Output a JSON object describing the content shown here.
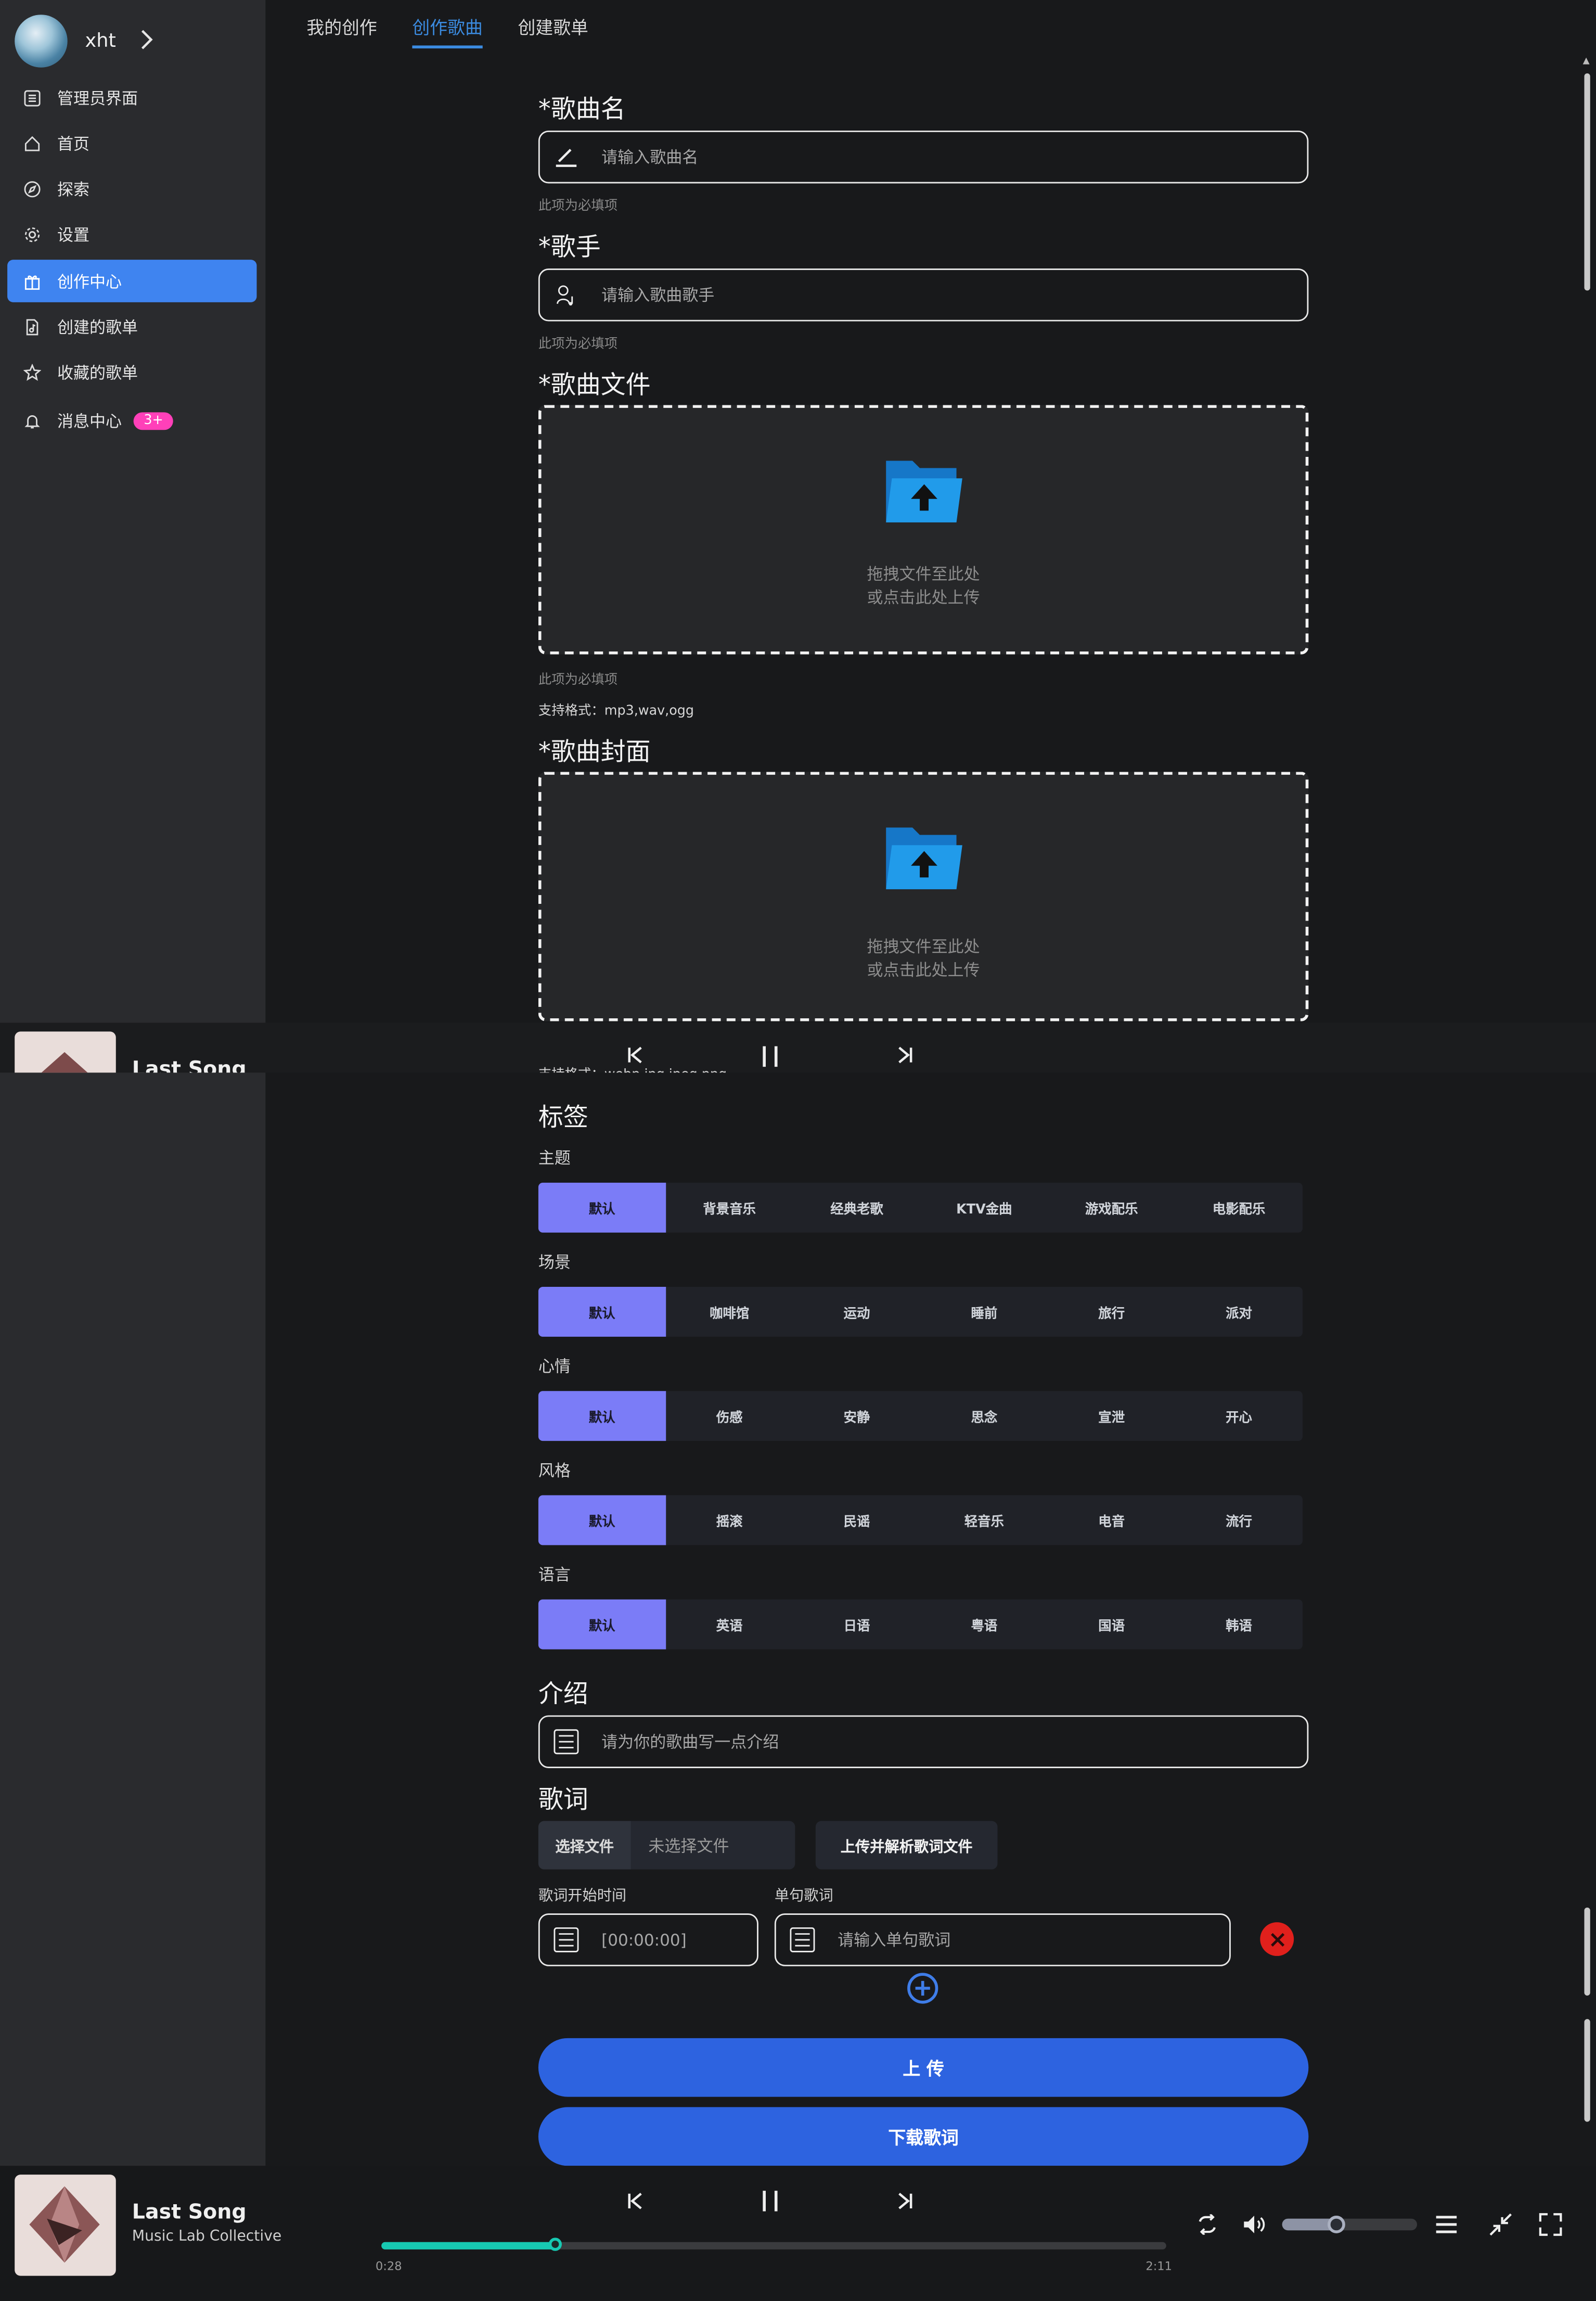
{
  "user": {
    "name": "xht"
  },
  "sidebar": {
    "items": [
      {
        "label": "管理员界面",
        "icon": "admin-panel-icon"
      },
      {
        "label": "首页",
        "icon": "home-icon"
      },
      {
        "label": "探索",
        "icon": "compass-icon"
      },
      {
        "label": "设置",
        "icon": "gear-icon"
      },
      {
        "label": "创作中心",
        "icon": "gift-icon",
        "active": true
      },
      {
        "label": "创建的歌单",
        "icon": "music-file-icon"
      },
      {
        "label": "收藏的歌单",
        "icon": "star-icon"
      },
      {
        "label": "消息中心",
        "icon": "bell-icon",
        "badge": "3+"
      }
    ]
  },
  "tabs": [
    {
      "label": "我的创作"
    },
    {
      "label": "创作歌曲",
      "active": true
    },
    {
      "label": "创建歌单"
    }
  ],
  "form": {
    "song_name": {
      "label": "*歌曲名",
      "placeholder": "请输入歌曲名",
      "hint": "此项为必填项"
    },
    "singer": {
      "label": "*歌手",
      "placeholder": "请输入歌曲歌手",
      "hint": "此项为必填项"
    },
    "song_file": {
      "label": "*歌曲文件",
      "drop_line1": "拖拽文件至此处",
      "drop_line2": "或点击此处上传",
      "hint": "此项为必填项",
      "formats": "支持格式：mp3,wav,ogg"
    },
    "cover": {
      "label": "*歌曲封面",
      "drop_line1": "拖拽文件至此处",
      "drop_line2": "或点击此处上传",
      "formats": "支持格式：webp,jpg,jpeg,png"
    },
    "tags": {
      "label": "标签",
      "groups": [
        {
          "name": "主题",
          "options": [
            "默认",
            "背景音乐",
            "经典老歌",
            "KTV金曲",
            "游戏配乐",
            "电影配乐"
          ],
          "selected": 0
        },
        {
          "name": "场景",
          "options": [
            "默认",
            "咖啡馆",
            "运动",
            "睡前",
            "旅行",
            "派对"
          ],
          "selected": 0
        },
        {
          "name": "心情",
          "options": [
            "默认",
            "伤感",
            "安静",
            "思念",
            "宣泄",
            "开心"
          ],
          "selected": 0
        },
        {
          "name": "风格",
          "options": [
            "默认",
            "摇滚",
            "民谣",
            "轻音乐",
            "电音",
            "流行"
          ],
          "selected": 0
        },
        {
          "name": "语言",
          "options": [
            "默认",
            "英语",
            "日语",
            "粤语",
            "国语",
            "韩语"
          ],
          "selected": 0
        }
      ]
    },
    "intro": {
      "label": "介绍",
      "placeholder": "请为你的歌曲写一点介绍"
    },
    "lyrics": {
      "label": "歌词",
      "choose_file": "选择文件",
      "no_file": "未选择文件",
      "upload_parse": "上传并解析歌词文件",
      "start_time_label": "歌词开始时间",
      "start_time_placeholder": "[00:00:00]",
      "line_label": "单句歌词",
      "line_placeholder": "请输入单句歌词"
    },
    "upload_button": "上 传",
    "download_button": "下载歌词"
  },
  "player": {
    "title": "Last Song",
    "artist": "Music Lab Collective",
    "current_time": "0:28",
    "duration": "2:11",
    "progress": 0.22,
    "volume": 0.4
  },
  "colors": {
    "accent": "#3f84f0",
    "tag_selected": "#7b7cf7",
    "primary_button": "#2d63e0",
    "progress": "#17c9b2",
    "badge": "#ff40b9",
    "delete": "#e0201c"
  }
}
